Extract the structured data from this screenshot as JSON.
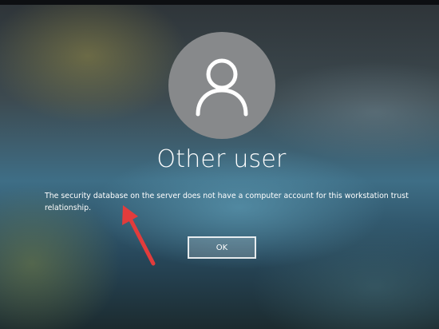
{
  "user": {
    "name": "Other user",
    "avatar_icon": "user-silhouette-icon"
  },
  "message": {
    "text": "The security database on the server does not have a computer account for this workstation trust relationship."
  },
  "ok_button": {
    "label": "OK"
  },
  "annotation": {
    "icon": "red-arrow-icon",
    "color": "#e23c3c"
  },
  "colors": {
    "avatar_circle": "#87898b",
    "text": "#ffffff"
  }
}
